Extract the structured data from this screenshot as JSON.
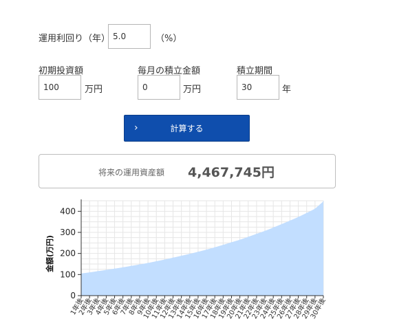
{
  "form": {
    "rate_label": "運用利回り（年）",
    "rate_value": "5.0",
    "rate_unit": "（%）",
    "initial_label": "初期投資額",
    "initial_value": "100",
    "initial_unit": "万円",
    "monthly_label": "毎月の積立金額",
    "monthly_value": "0",
    "monthly_unit": "万円",
    "period_label": "積立期間",
    "period_value": "30",
    "period_unit": "年"
  },
  "button": {
    "label": "計算する",
    "icon": "chevron-right-icon"
  },
  "result": {
    "label": "将来の運用資産額",
    "value": "4,467,745円"
  },
  "chart_data": {
    "type": "area",
    "ylabel": "金額(万円)",
    "xlabel": "",
    "ylim": [
      0,
      450
    ],
    "yticks": [
      0,
      100,
      200,
      300,
      400
    ],
    "grid": true,
    "fill_color": "#c2deff",
    "categories": [
      "1年後",
      "2年後",
      "3年後",
      "4年後",
      "5年後",
      "6年後",
      "7年後",
      "8年後",
      "9年後",
      "10年後",
      "11年後",
      "12年後",
      "13年後",
      "14年後",
      "15年後",
      "16年後",
      "17年後",
      "18年後",
      "19年後",
      "20年後",
      "21年後",
      "22年後",
      "23年後",
      "24年後",
      "25年後",
      "26年後",
      "27年後",
      "28年後",
      "29年後",
      "30年後"
    ],
    "values": [
      105,
      110,
      116,
      122,
      128,
      134,
      141,
      148,
      155,
      163,
      171,
      180,
      189,
      198,
      208,
      218,
      229,
      241,
      253,
      265,
      279,
      293,
      307,
      323,
      339,
      356,
      373,
      392,
      412,
      447
    ]
  }
}
